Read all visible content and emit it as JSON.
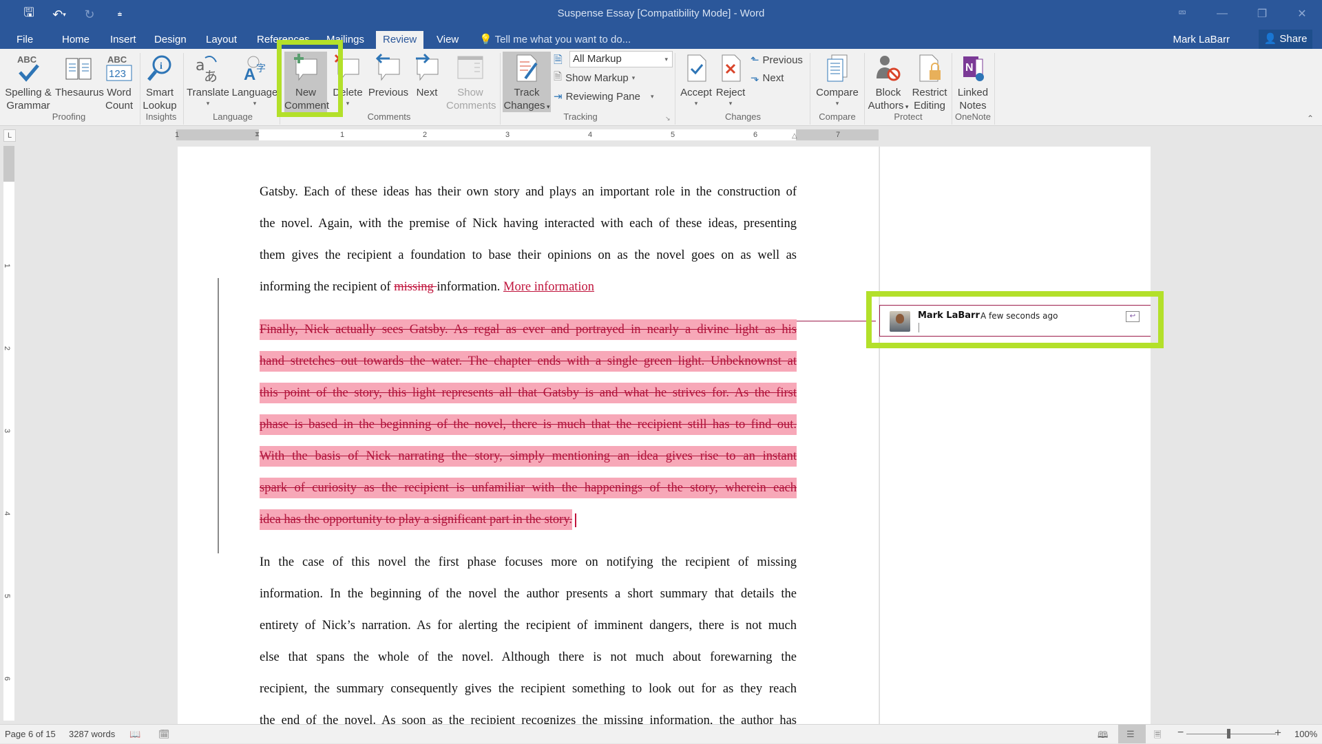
{
  "titlebar": {
    "title": "Suspense Essay [Compatibility Mode] - Word",
    "qat": [
      "save-icon",
      "undo-icon",
      "redo-icon",
      "customize-qat-icon"
    ],
    "window_controls": [
      "ribbon-display-options",
      "minimize",
      "restore",
      "close"
    ]
  },
  "tabs": {
    "items": [
      {
        "label": "File"
      },
      {
        "label": "Home"
      },
      {
        "label": "Insert"
      },
      {
        "label": "Design"
      },
      {
        "label": "Layout"
      },
      {
        "label": "References"
      },
      {
        "label": "Mailings"
      },
      {
        "label": "Review"
      },
      {
        "label": "View"
      }
    ],
    "active": "Review",
    "tell_me": "Tell me what you want to do...",
    "user": "Mark LaBarr",
    "share": "Share"
  },
  "ribbon": {
    "proofing": {
      "label": "Proofing",
      "spelling": [
        "Spelling &",
        "Grammar"
      ],
      "thesaurus": "Thesaurus",
      "word_count": [
        "Word",
        "Count"
      ]
    },
    "insights": {
      "label": "Insights",
      "smart_lookup": [
        "Smart",
        "Lookup"
      ]
    },
    "language": {
      "label": "Language",
      "translate": "Translate",
      "language": "Language"
    },
    "comments": {
      "label": "Comments",
      "new": [
        "New",
        "Comment"
      ],
      "delete": "Delete",
      "previous": "Previous",
      "next": "Next",
      "show": [
        "Show",
        "Comments"
      ]
    },
    "tracking": {
      "label": "Tracking",
      "track": [
        "Track",
        "Changes"
      ],
      "markup_value": "All Markup",
      "show_markup": "Show Markup",
      "reviewing_pane": "Reviewing Pane"
    },
    "changes": {
      "label": "Changes",
      "accept": "Accept",
      "reject": "Reject",
      "previous": "Previous",
      "next": "Next"
    },
    "compare": {
      "label": "Compare",
      "compare": "Compare"
    },
    "protect": {
      "label": "Protect",
      "block": [
        "Block",
        "Authors"
      ],
      "restrict": [
        "Restrict",
        "Editing"
      ]
    },
    "onenote": {
      "label": "OneNote",
      "linked": [
        "Linked",
        "Notes"
      ]
    }
  },
  "ruler": {
    "h_numbers": [
      "1",
      "1",
      "2",
      "3",
      "4",
      "5",
      "6",
      "7"
    ],
    "v_numbers": [
      "1",
      "2",
      "3",
      "4",
      "5",
      "6"
    ],
    "tab_selector": "L"
  },
  "document": {
    "para1": [
      "Gatsby. Each of these ideas has their own story and plays an important role in the construction of",
      "the novel. Again, with the premise of Nick having interacted with each of these ideas, presenting",
      "them gives the recipient a foundation to base their opinions on as the novel goes on as well as"
    ],
    "para1_last": {
      "before": "informing the recipient of ",
      "deleted": "missing ",
      "after": "information. ",
      "inserted": "More information"
    },
    "deleted_para": [
      "Finally, Nick actually sees Gatsby. As regal as ever and portrayed in nearly a divine light as his",
      "hand stretches out towards the water. The chapter ends with a single green light. Unbeknownst at",
      "this point of the story, this light represents all that Gatsby is and what he strives for. As the first",
      "phase is based in the beginning of the novel, there is much that the recipient still has to find out.",
      "With the basis of Nick narrating the story, simply mentioning an idea gives rise to an instant",
      "spark of curiosity as the recipient is unfamiliar with the happenings of the story, wherein each",
      "idea has the opportunity to play a significant part in the story."
    ],
    "para3": [
      "In the case of this novel the first phase focuses more on notifying the recipient of missing",
      "information. In the beginning of the novel the author presents a short summary that details the",
      "entirety of Nick’s narration. As for alerting the recipient of imminent dangers, there is not much",
      "else that spans the whole of the novel. Although there is not much about forewarning the",
      "recipient, the summary consequently gives the recipient something to look out for as they reach",
      "the end of the novel. As soon as the recipient recognizes the missing information, the author has"
    ]
  },
  "comment": {
    "author": "Mark LaBarr",
    "time": "A few seconds ago",
    "text": ""
  },
  "status": {
    "page": "Page 6 of 15",
    "words": "3287 words",
    "zoom": "100%",
    "zoom_percent": 100
  },
  "colors": {
    "accent": "#2b579a",
    "highlight": "#b3e02a",
    "revision": "#c0143c",
    "deleted_bg": "#f7a8b8"
  }
}
